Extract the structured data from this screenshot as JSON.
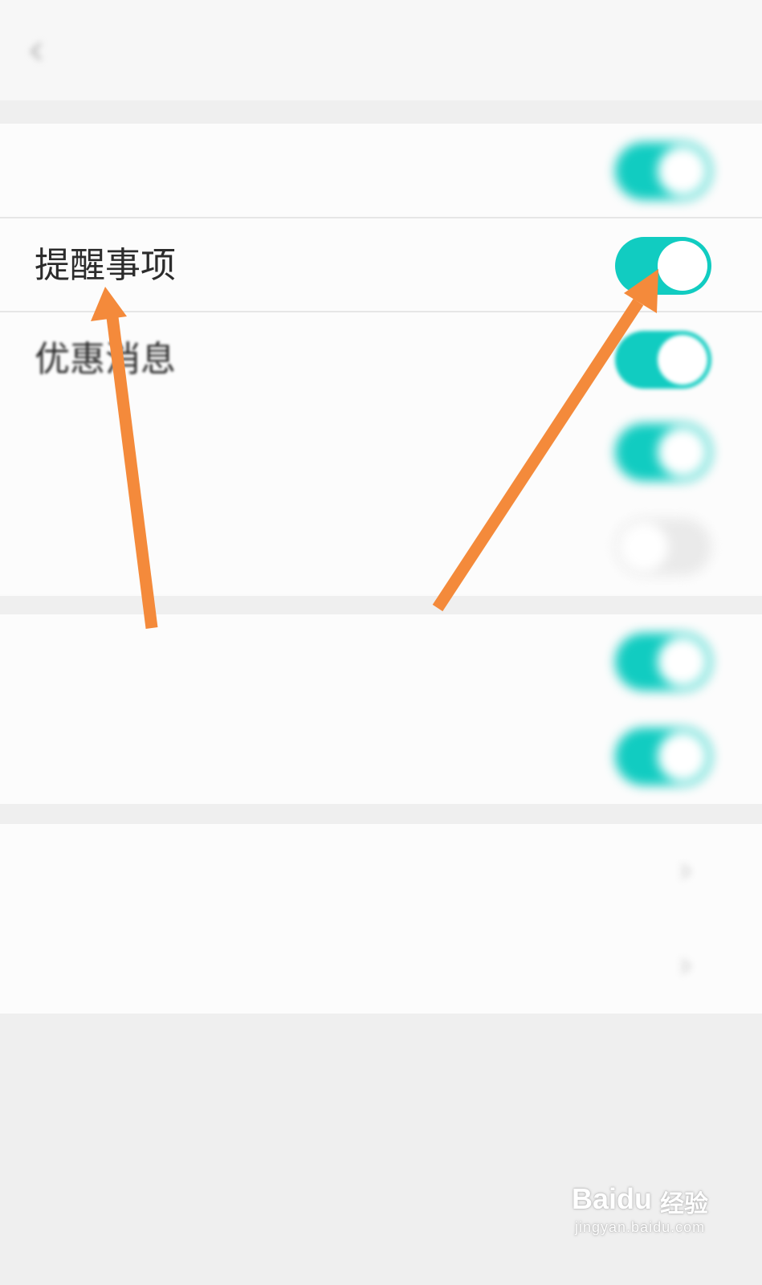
{
  "header": {
    "back_icon": "chevron-left-icon",
    "title": ""
  },
  "section1": {
    "rows": [
      {
        "label": "",
        "toggle": "on"
      },
      {
        "label": "提醒事项",
        "toggle": "on"
      },
      {
        "label": "优惠消息",
        "toggle": "on"
      },
      {
        "label": "",
        "toggle": "on"
      },
      {
        "label": "",
        "toggle": "off"
      }
    ]
  },
  "section2": {
    "rows": [
      {
        "label": "",
        "toggle": "on"
      },
      {
        "label": "",
        "toggle": "on"
      }
    ]
  },
  "section3": {
    "rows": [
      {
        "label": "",
        "icon": "chevron-right-icon"
      },
      {
        "label": "",
        "icon": "chevron-right-icon"
      }
    ]
  },
  "watermark": {
    "logo": "Baidu",
    "sub": "经验",
    "url": "jingyan.baidu.com"
  },
  "colors": {
    "accent": "#11ccc1",
    "arrow": "#f48a3b",
    "background": "#efefef"
  }
}
